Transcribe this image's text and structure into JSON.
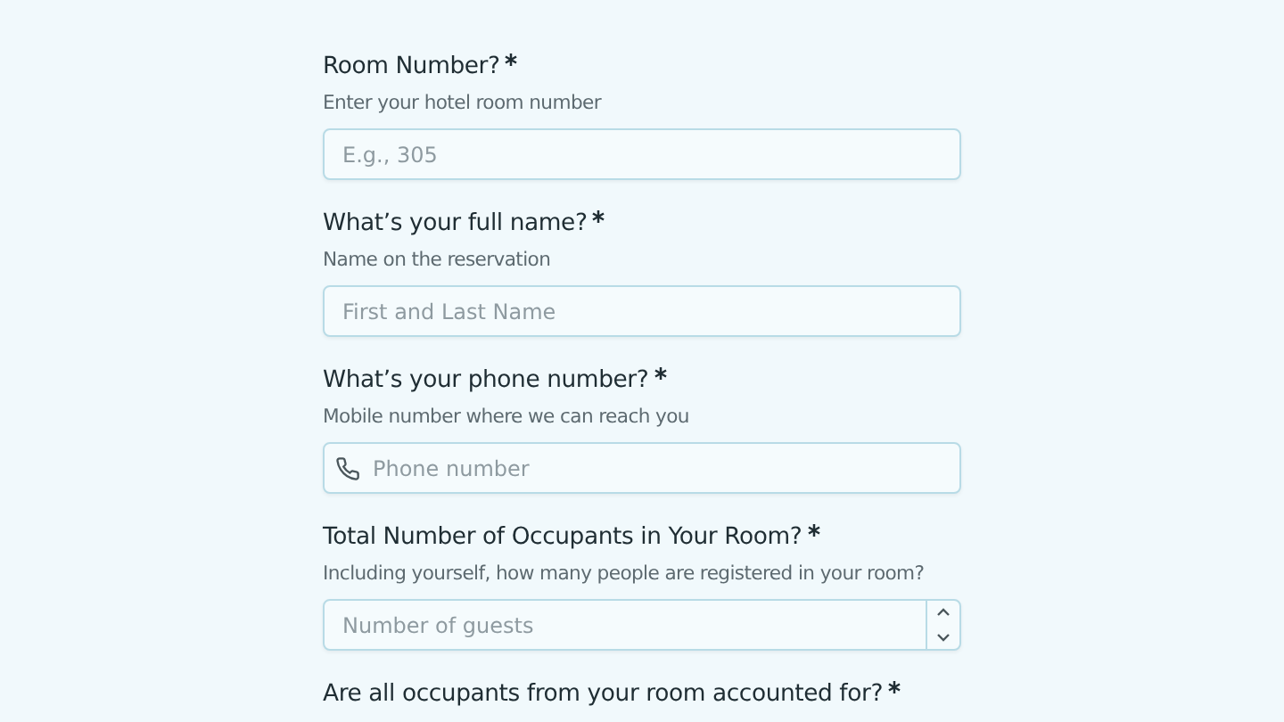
{
  "questions": [
    {
      "label": "Room Number?",
      "required": true,
      "help": "Enter your hotel room number",
      "field": {
        "kind": "text",
        "placeholder": "E.g., 305"
      }
    },
    {
      "label": "What’s your full name?",
      "required": true,
      "help": "Name on the reservation",
      "field": {
        "kind": "text",
        "placeholder": "First and Last Name"
      }
    },
    {
      "label": "What’s your phone number?",
      "required": true,
      "help": "Mobile number where we can reach you",
      "field": {
        "kind": "phone",
        "placeholder": "Phone number"
      }
    },
    {
      "label": "Total Number of Occupants in Your Room?",
      "required": true,
      "help": "Including yourself, how many people are registered in your room?",
      "field": {
        "kind": "number",
        "placeholder": "Number of guests"
      }
    },
    {
      "label": "Are all occupants from your room accounted for?",
      "required": true
    }
  ]
}
